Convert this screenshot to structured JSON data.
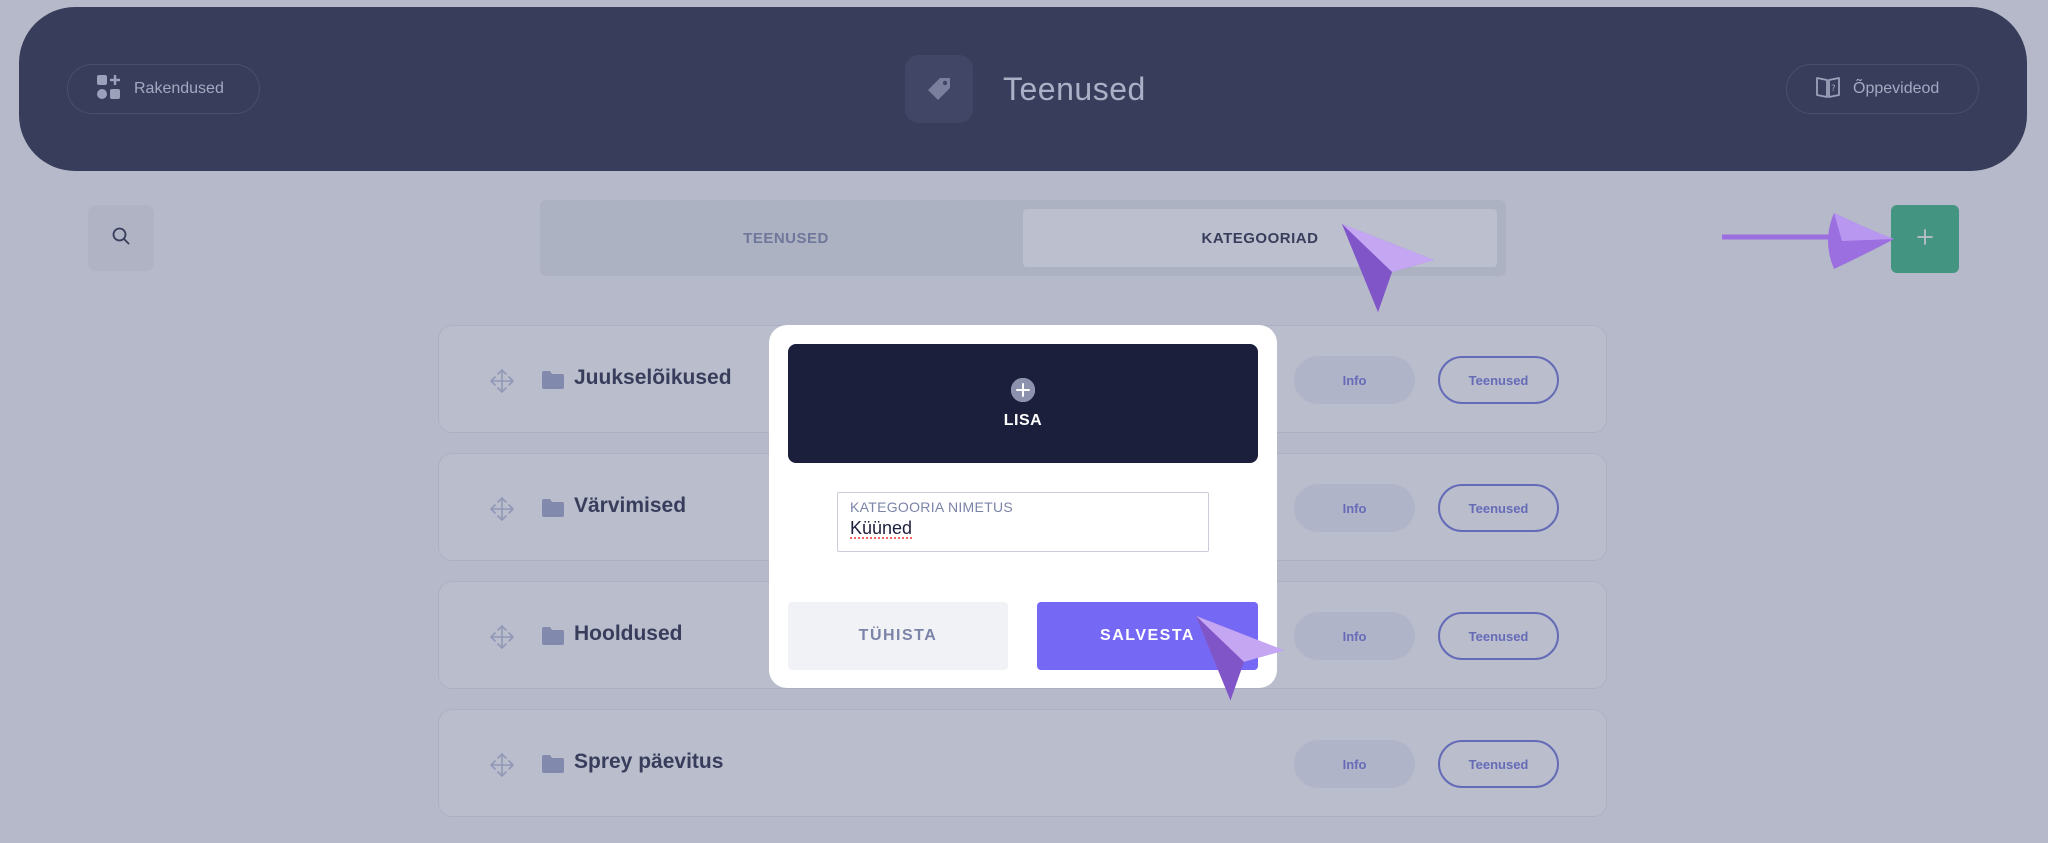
{
  "header": {
    "apps_label": "Rakendused",
    "title": "Teenused",
    "videos_label": "Õppevideod"
  },
  "toolbar": {
    "tabs": [
      {
        "label": "TEENUSED",
        "active": false
      },
      {
        "label": "KATEGOORIAD",
        "active": true
      }
    ]
  },
  "categories": [
    {
      "name": "Juukselõikused",
      "info_label": "Info",
      "services_label": "Teenused"
    },
    {
      "name": "Värvimised",
      "info_label": "Info",
      "services_label": "Teenused"
    },
    {
      "name": "Hooldused",
      "info_label": "Info",
      "services_label": "Teenused"
    },
    {
      "name": "Sprey päevitus",
      "info_label": "Info",
      "services_label": "Teenused"
    }
  ],
  "modal": {
    "title": "LISA",
    "field_label": "KATEGOORIA NIMETUS",
    "field_value": "Küüned",
    "cancel_label": "TÜHISTA",
    "save_label": "SALVESTA"
  },
  "colors": {
    "header_bg": "#1b1f3b",
    "accent_green": "#2fb57d",
    "accent_purple": "#7468f5",
    "link_purple": "#6b6fdb",
    "pointer_purple": "#9b6fe0"
  }
}
